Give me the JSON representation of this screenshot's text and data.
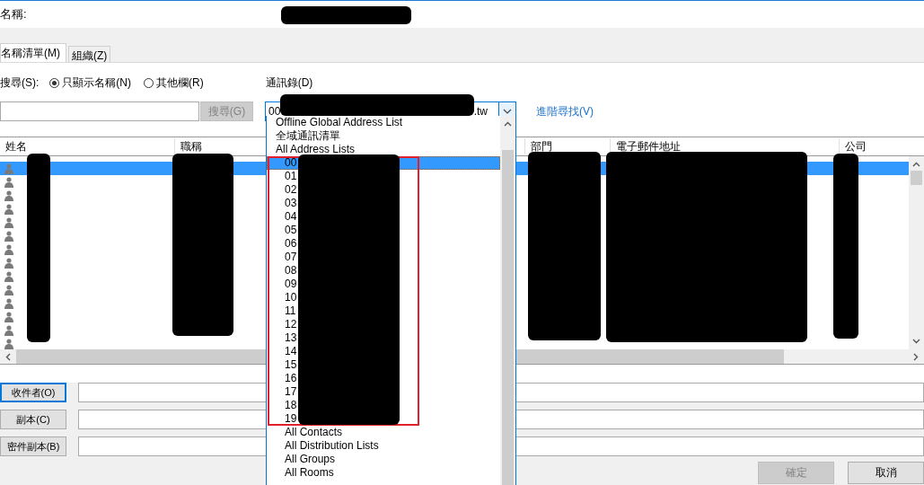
{
  "title_label": "名稱:",
  "tabs": [
    {
      "label": "名稱清單(M)",
      "selected": true
    },
    {
      "label": "組織(Z)",
      "selected": false
    }
  ],
  "search": {
    "label": "搜尋(S):",
    "options": [
      {
        "label": "只顯示名稱(N)",
        "selected": true
      },
      {
        "label": "其他欄(R)",
        "selected": false
      }
    ],
    "button": "搜尋(G)",
    "button_disabled": true
  },
  "address_book": {
    "label": "通訊錄(D)",
    "value_start": "00",
    "value_end": ".tw",
    "advanced_link": "進階尋找(V)",
    "items": [
      {
        "label": "Offline Global Address List",
        "selected": false
      },
      {
        "label": "全域通訊清單",
        "selected": false
      },
      {
        "label": "All Address Lists",
        "selected": false,
        "children": [
          {
            "label": "00",
            "selected": true
          },
          {
            "label": "01",
            "selected": false
          },
          {
            "label": "02",
            "selected": false
          },
          {
            "label": "03",
            "selected": false
          },
          {
            "label": "04",
            "selected": false
          },
          {
            "label": "05",
            "selected": false
          },
          {
            "label": "06",
            "selected": false
          },
          {
            "label": "07",
            "selected": false
          },
          {
            "label": "08",
            "selected": false
          },
          {
            "label": "09",
            "selected": false
          },
          {
            "label": "10",
            "selected": false
          },
          {
            "label": "11",
            "selected": false
          },
          {
            "label": "12",
            "selected": false
          },
          {
            "label": "13",
            "selected": false
          },
          {
            "label": "14",
            "selected": false
          },
          {
            "label": "15",
            "selected": false
          },
          {
            "label": "16",
            "selected": false
          },
          {
            "label": "17",
            "selected": false
          },
          {
            "label": "18",
            "selected": false
          },
          {
            "label": "19",
            "selected": false
          },
          {
            "label": "All Contacts",
            "selected": false
          },
          {
            "label": "All Distribution Lists",
            "selected": false
          },
          {
            "label": "All Groups",
            "selected": false
          },
          {
            "label": "All Rooms",
            "selected": false
          }
        ]
      }
    ]
  },
  "table": {
    "columns": [
      "姓名",
      "職稱",
      "部門",
      "電子郵件地址",
      "公司"
    ],
    "rows": [
      {
        "selected": true
      },
      {
        "selected": false
      },
      {
        "selected": false
      },
      {
        "selected": false
      },
      {
        "selected": false
      },
      {
        "selected": false
      },
      {
        "selected": false
      },
      {
        "selected": false
      },
      {
        "selected": false
      },
      {
        "selected": false
      },
      {
        "selected": false
      },
      {
        "selected": false
      },
      {
        "selected": false
      },
      {
        "selected": false
      }
    ]
  },
  "recipients": [
    {
      "label": "收件者(O)",
      "focused": true
    },
    {
      "label": "副本(C)",
      "focused": false
    },
    {
      "label": "密件副本(B)",
      "focused": false
    }
  ],
  "buttons": [
    {
      "label": "確定",
      "disabled": true
    },
    {
      "label": "取消",
      "disabled": false
    }
  ]
}
